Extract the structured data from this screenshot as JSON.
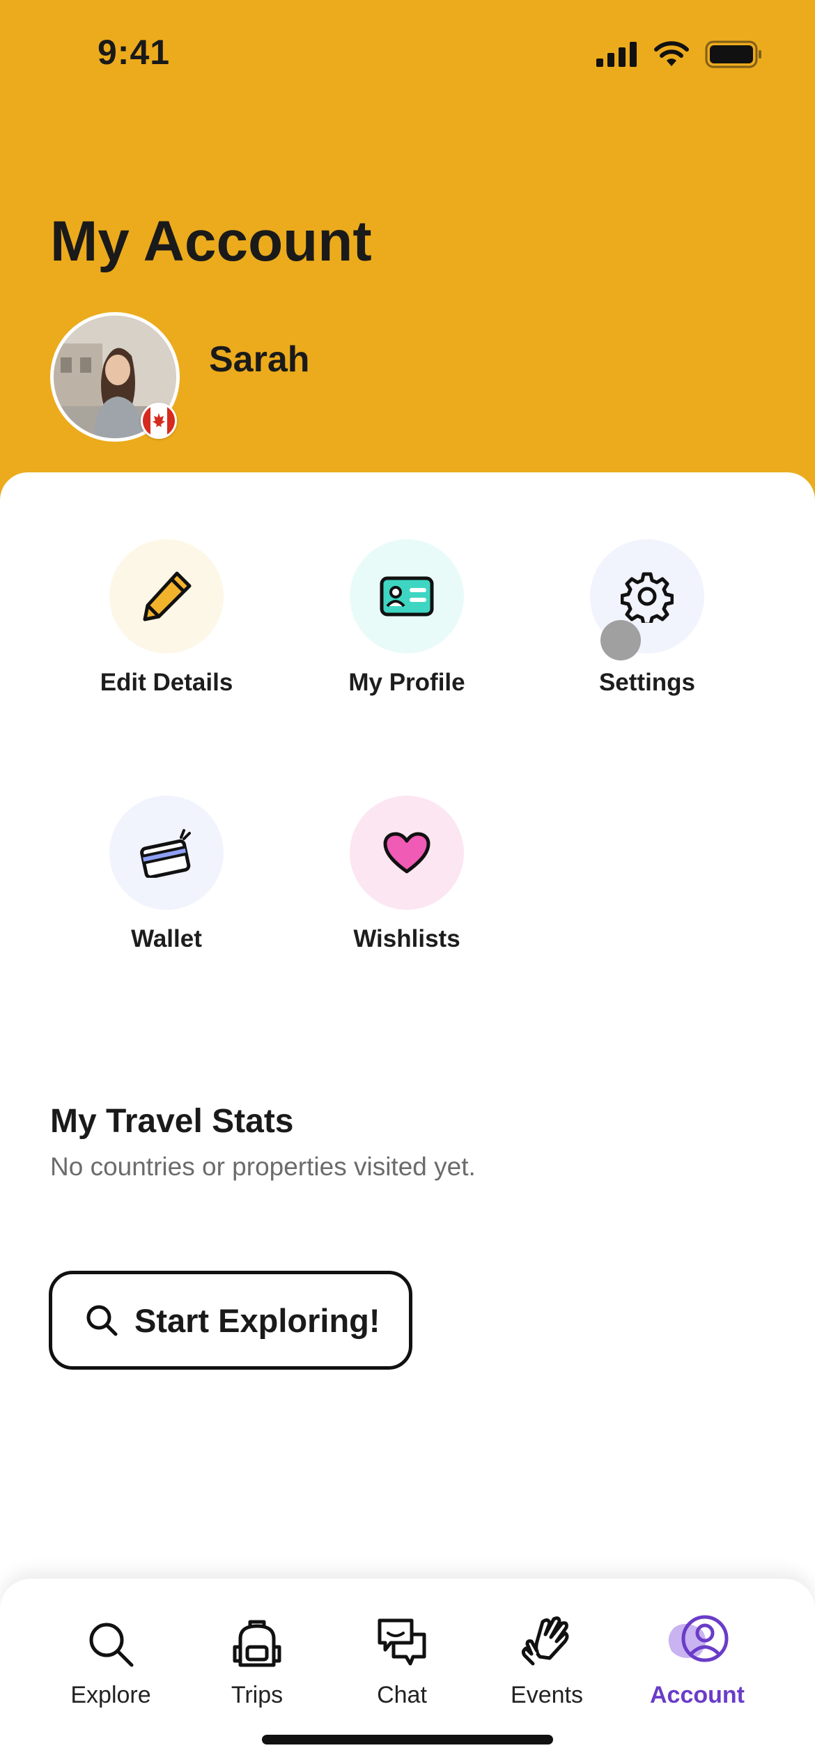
{
  "status_bar": {
    "time": "9:41"
  },
  "header": {
    "title": "My Account",
    "user_name": "Sarah"
  },
  "actions": [
    {
      "label": "Edit Details",
      "icon": "pencil-icon",
      "bg": "#FDF7E8"
    },
    {
      "label": "My Profile",
      "icon": "id-card-icon",
      "bg": "#E9FBF9"
    },
    {
      "label": "Settings",
      "icon": "gear-icon",
      "bg": "#F1F3FD"
    },
    {
      "label": "Wallet",
      "icon": "credit-card-icon",
      "bg": "#F1F3FD"
    },
    {
      "label": "Wishlists",
      "icon": "heart-icon",
      "bg": "#FCE6F2"
    }
  ],
  "travel_stats": {
    "title": "My Travel Stats",
    "subtitle": "No countries or properties visited yet."
  },
  "start_button": {
    "label": "Start Exploring!"
  },
  "tabs": [
    {
      "label": "Explore",
      "icon": "search-icon"
    },
    {
      "label": "Trips",
      "icon": "backpack-icon"
    },
    {
      "label": "Chat",
      "icon": "chat-bubbles-icon"
    },
    {
      "label": "Events",
      "icon": "waving-hands-icon"
    },
    {
      "label": "Account",
      "icon": "user-circle-icon",
      "active": true
    }
  ],
  "colors": {
    "header_bg": "#ECAB1D",
    "accent": "#6A3CC8"
  }
}
